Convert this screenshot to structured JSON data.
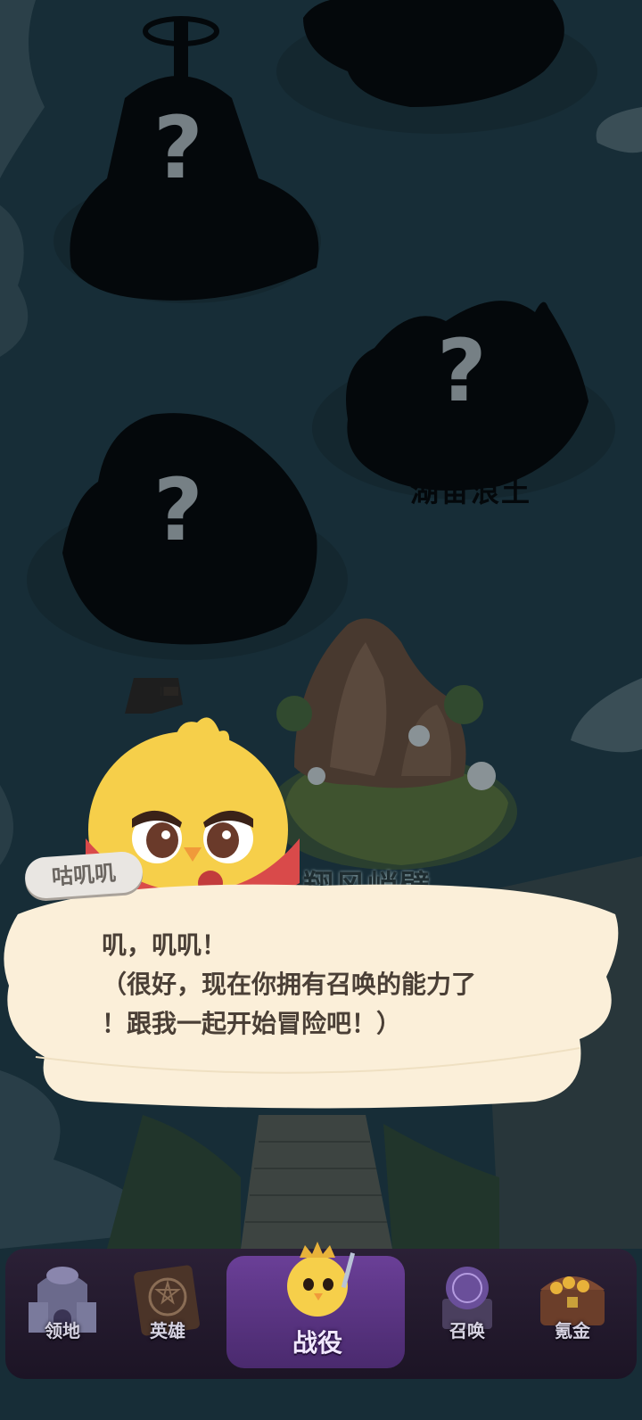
{
  "map": {
    "locked_stages": [
      {
        "mark": "?",
        "label": ""
      },
      {
        "mark": "?",
        "label": "湖宙浪土"
      },
      {
        "mark": "?",
        "label": ""
      }
    ],
    "unlocked_stage_label": "翔风峭壁"
  },
  "dialog": {
    "speaker": "咕叽叽",
    "text": "叽，叽叽！\n（很好，现在你拥有召唤的能力了\n！跟我一起开始冒险吧！）"
  },
  "nav": {
    "items": [
      {
        "label": "领地",
        "icon": "castle-icon"
      },
      {
        "label": "英雄",
        "icon": "spellbook-icon"
      },
      {
        "label": "战役",
        "icon": "chick-king-icon",
        "active": true
      },
      {
        "label": "召唤",
        "icon": "summon-portal-icon"
      },
      {
        "label": "氪金",
        "icon": "treasure-chest-icon"
      }
    ]
  },
  "colors": {
    "sea": "#1d3a44",
    "dialog_bg": "#fbefd9",
    "nav_active": "#6a3f97",
    "chick": "#f6cf4a",
    "scarf": "#d94a4a"
  }
}
